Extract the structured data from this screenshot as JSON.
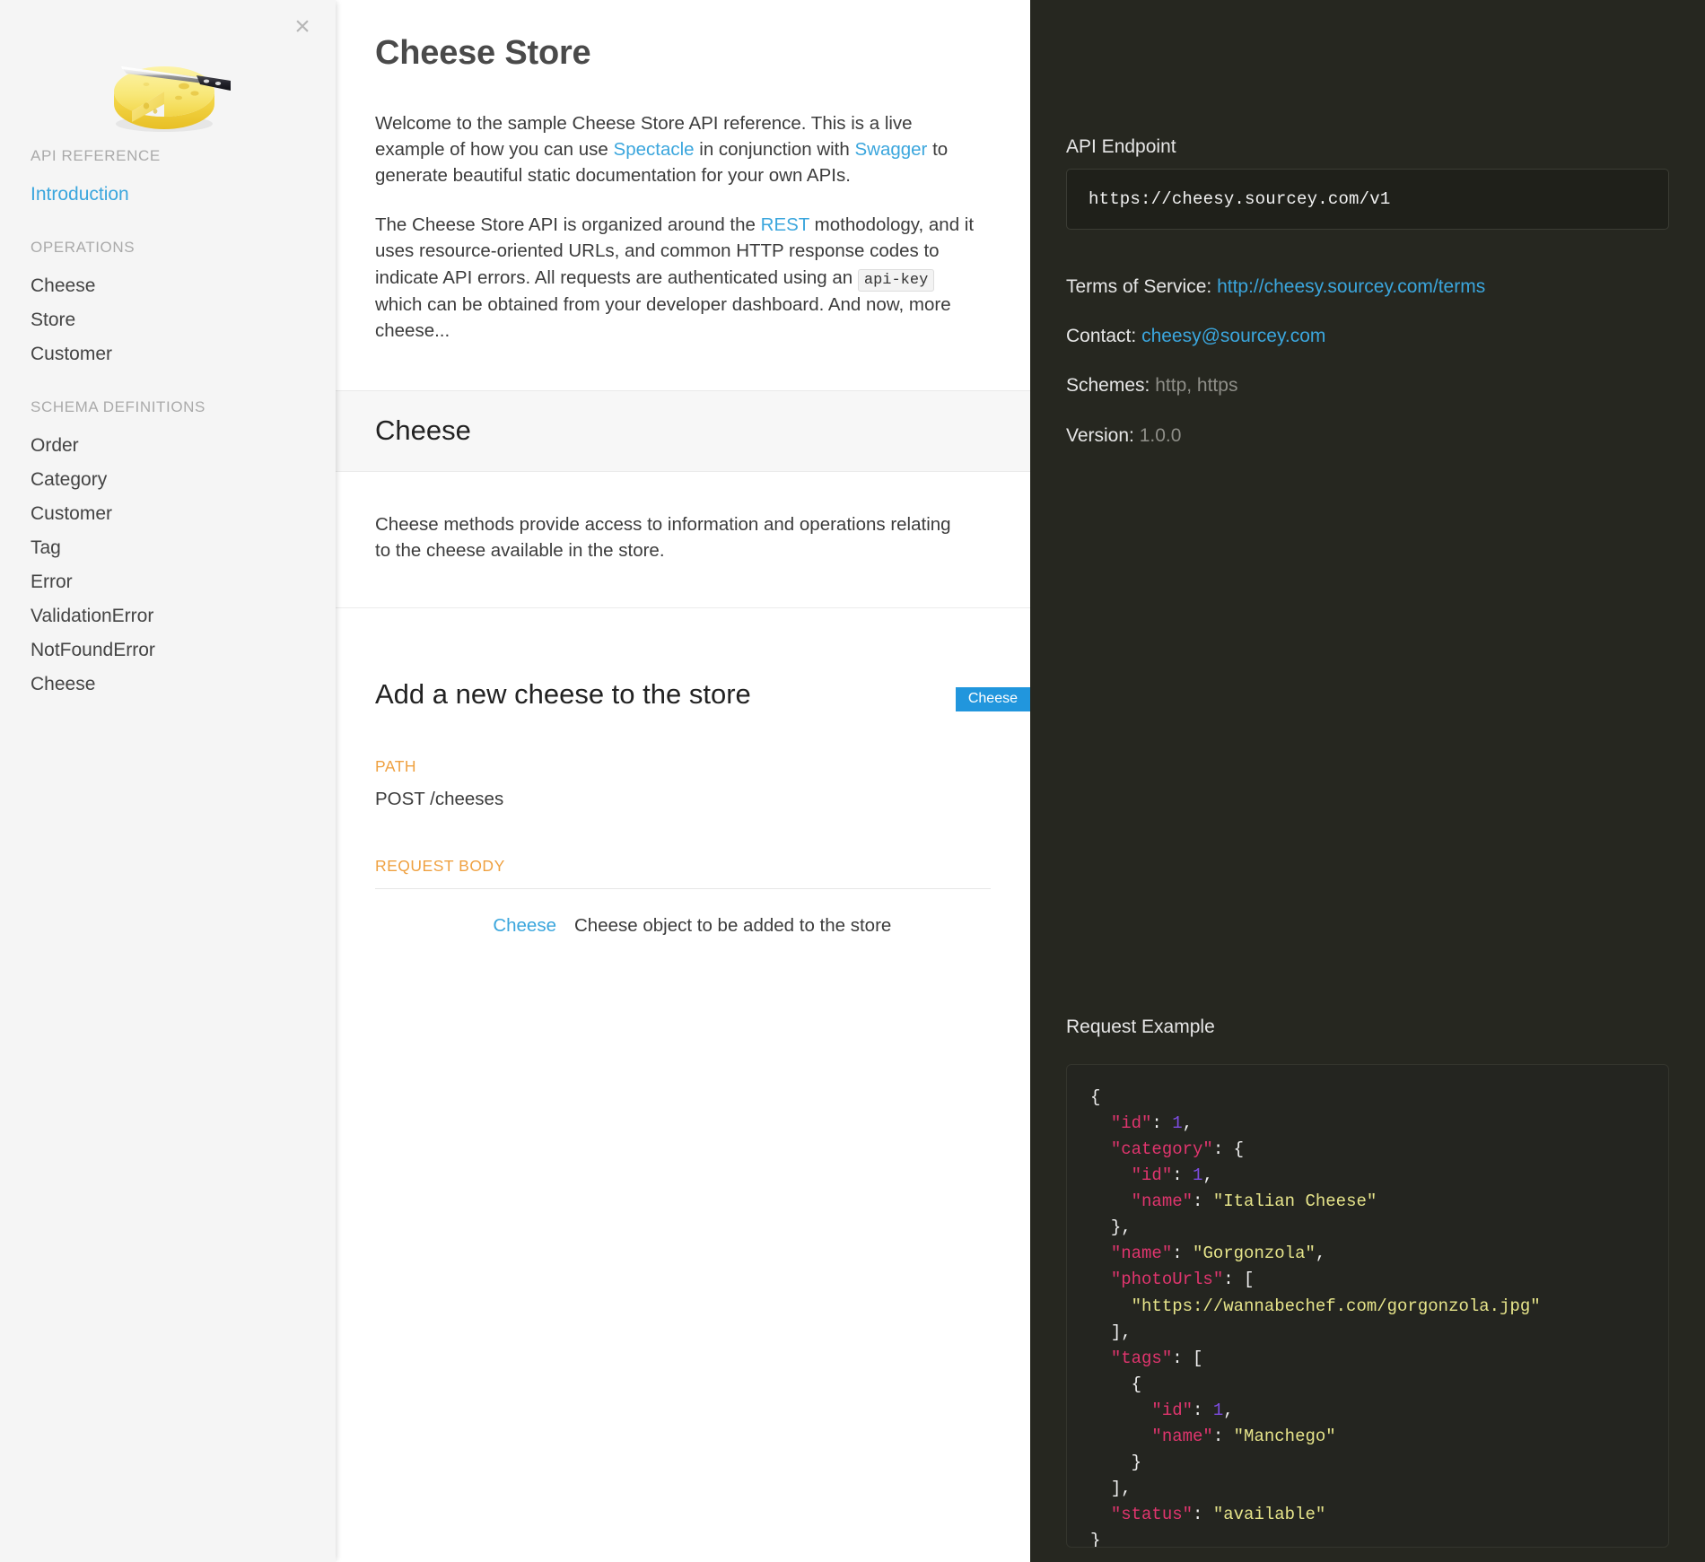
{
  "sidebar": {
    "close_label": "×",
    "logo_alt": "cheese-wheel-with-knife-logo",
    "groups": [
      {
        "heading": "API REFERENCE",
        "items": [
          {
            "label": "Introduction",
            "active": true
          }
        ]
      },
      {
        "heading": "OPERATIONS",
        "items": [
          {
            "label": "Cheese",
            "active": false
          },
          {
            "label": "Store",
            "active": false
          },
          {
            "label": "Customer",
            "active": false
          }
        ]
      },
      {
        "heading": "SCHEMA DEFINITIONS",
        "items": [
          {
            "label": "Order",
            "active": false
          },
          {
            "label": "Category",
            "active": false
          },
          {
            "label": "Customer",
            "active": false
          },
          {
            "label": "Tag",
            "active": false
          },
          {
            "label": "Error",
            "active": false
          },
          {
            "label": "ValidationError",
            "active": false
          },
          {
            "label": "NotFoundError",
            "active": false
          },
          {
            "label": "Cheese",
            "active": false
          }
        ]
      }
    ]
  },
  "main": {
    "page_title": "Cheese Store",
    "intro": {
      "p1_part1": "Welcome to the sample Cheese Store API reference. This is a live example of how you can use ",
      "p1_link1": "Spectacle",
      "p1_part2": " in conjunction with ",
      "p1_link2": "Swagger",
      "p1_part3": " to generate beautiful static documentation for your own APIs.",
      "p2_part1": "The Cheese Store API is organized around the ",
      "p2_link1": "REST",
      "p2_part2": " mothodology, and it uses resource-oriented URLs, and common HTTP response codes to indicate API errors. All requests are authenticated using an ",
      "p2_code": "api-key",
      "p2_part3": " which can be obtained from your developer dashboard. And now, more cheese..."
    },
    "section": {
      "title": "Cheese",
      "description": "Cheese methods provide access to information and operations relating to the cheese available in the store."
    },
    "operation": {
      "tag_badge": "Cheese",
      "title": "Add a new cheese to the store",
      "path_label": "PATH",
      "path_value": "POST /cheeses",
      "request_body_label": "REQUEST BODY",
      "request_body_rows": [
        {
          "name": "Cheese",
          "description": "Cheese object to be added to the store"
        }
      ]
    }
  },
  "rightpanel": {
    "endpoint_label": "API Endpoint",
    "endpoint_url": "https://cheesy.sourcey.com/v1",
    "meta": [
      {
        "label": "Terms of Service:",
        "value": "http://cheesy.sourcey.com/terms",
        "style": "link"
      },
      {
        "label": "Contact:",
        "value": "cheesy@sourcey.com",
        "style": "link"
      },
      {
        "label": "Schemes:",
        "value": "http, https",
        "style": "muted"
      },
      {
        "label": "Version:",
        "value": "1.0.0",
        "style": "muted"
      }
    ],
    "request_example_label": "Request Example",
    "request_example_json": {
      "id": 1,
      "category": {
        "id": 1,
        "name": "Italian Cheese"
      },
      "name": "Gorgonzola",
      "photoUrls": [
        "https://wannabechef.com/gorgonzola.jpg"
      ],
      "tags": [
        {
          "id": 1,
          "name": "Manchego"
        }
      ],
      "status": "available"
    }
  },
  "colors": {
    "accent_blue": "#3ba6dd",
    "badge_blue": "#2196dd",
    "field_label_orange": "#efa141",
    "dark_panel": "#262720",
    "sidebar_bg": "#f5f5f5",
    "json_key": "#e0356e",
    "json_string": "#e6e48a",
    "json_number": "#7d4ce0"
  }
}
